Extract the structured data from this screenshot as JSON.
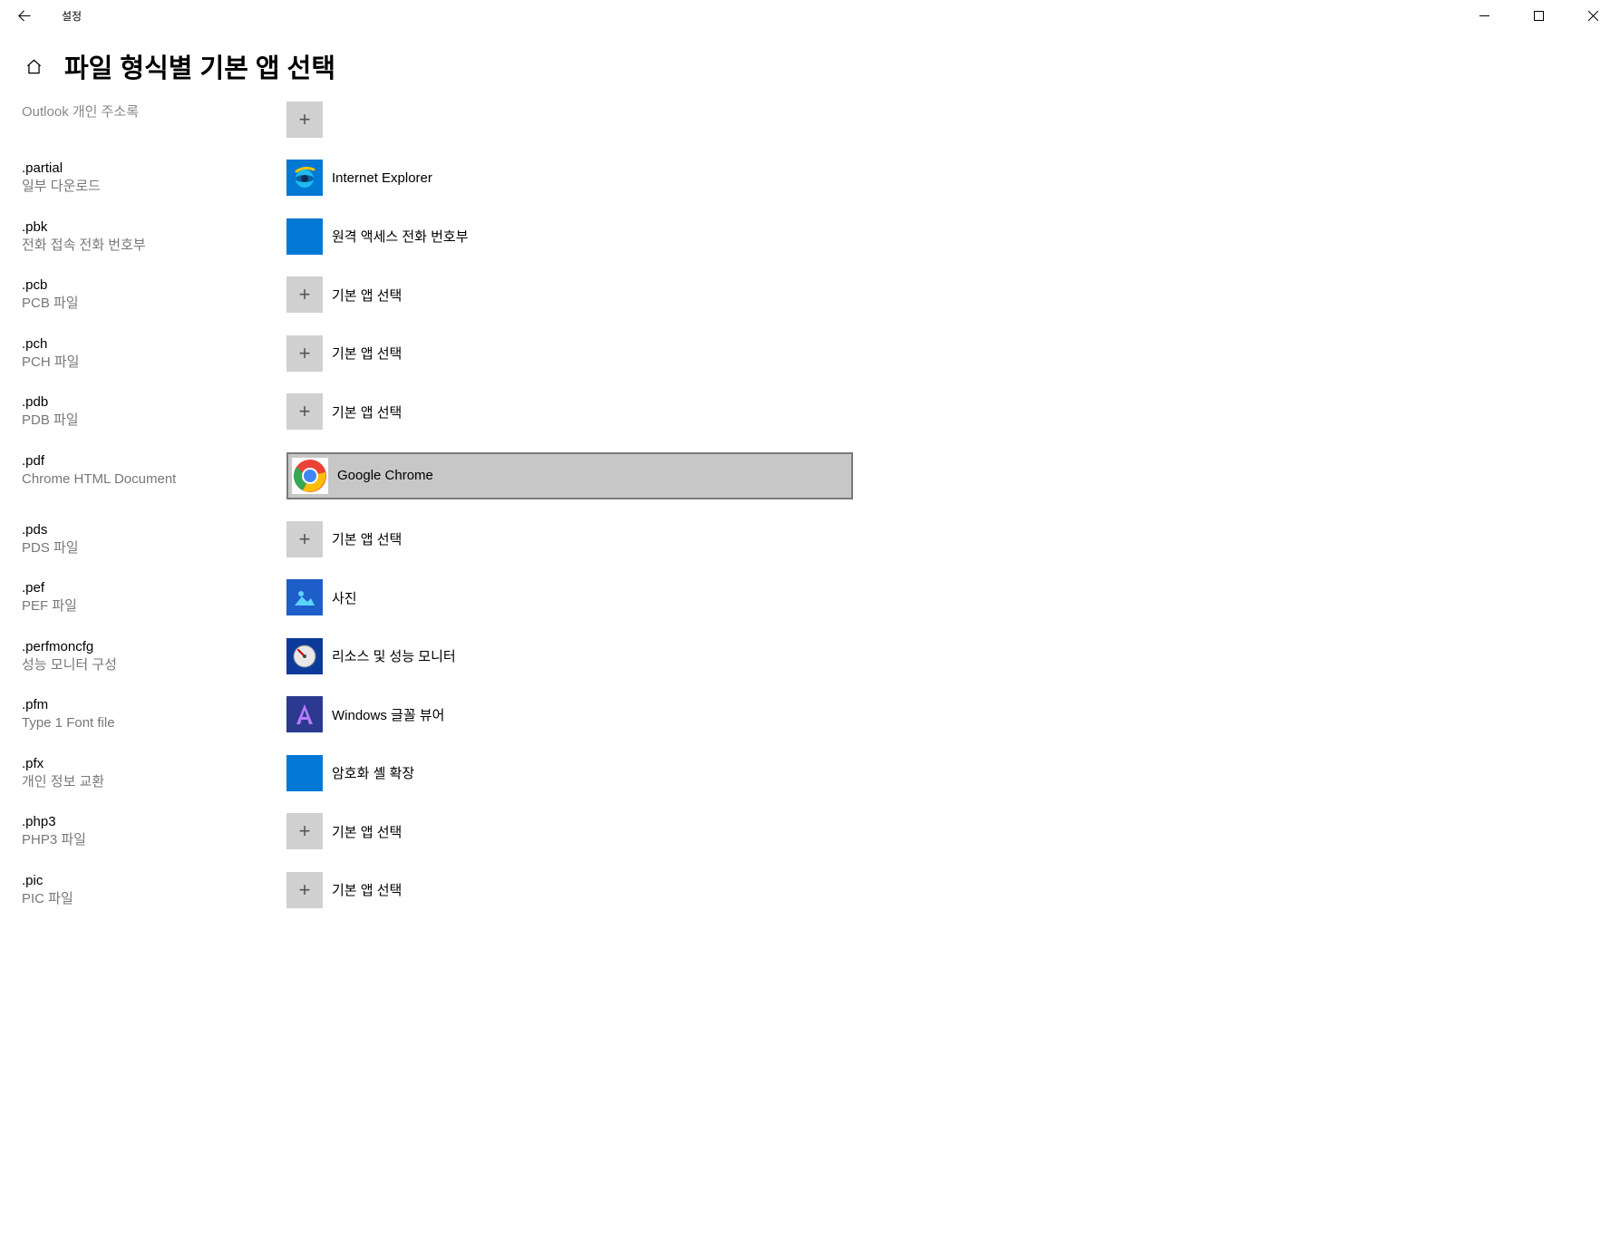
{
  "window": {
    "title": "설정"
  },
  "page": {
    "heading": "파일 형식별 기본 앱 선택"
  },
  "labels": {
    "choose_default": "기본 앱 선택"
  },
  "partial_top": {
    "desc": "Outlook 개인 주소록"
  },
  "rows": [
    {
      "ext": ".partial",
      "desc": "일부 다운로드",
      "app": "Internet Explorer",
      "icon": "ie"
    },
    {
      "ext": ".pbk",
      "desc": "전화 접속 전화 번호부",
      "app": "원격 액세스 전화 번호부",
      "icon": "blue"
    },
    {
      "ext": ".pcb",
      "desc": "PCB 파일",
      "app": "기본 앱 선택",
      "icon": "plus"
    },
    {
      "ext": ".pch",
      "desc": "PCH 파일",
      "app": "기본 앱 선택",
      "icon": "plus"
    },
    {
      "ext": ".pdb",
      "desc": "PDB 파일",
      "app": "기본 앱 선택",
      "icon": "plus"
    },
    {
      "ext": ".pdf",
      "desc": "Chrome HTML Document",
      "app": "Google Chrome",
      "icon": "chrome",
      "selected": true
    },
    {
      "ext": ".pds",
      "desc": "PDS 파일",
      "app": "기본 앱 선택",
      "icon": "plus"
    },
    {
      "ext": ".pef",
      "desc": "PEF 파일",
      "app": "사진",
      "icon": "photos"
    },
    {
      "ext": ".perfmoncfg",
      "desc": "성능 모니터 구성",
      "app": "리소스 및 성능 모니터",
      "icon": "perfmon"
    },
    {
      "ext": ".pfm",
      "desc": "Type 1 Font file",
      "app": "Windows 글꼴 뷰어",
      "icon": "font"
    },
    {
      "ext": ".pfx",
      "desc": "개인 정보 교환",
      "app": "암호화 셸 확장",
      "icon": "blue"
    },
    {
      "ext": ".php3",
      "desc": "PHP3 파일",
      "app": "기본 앱 선택",
      "icon": "plus"
    },
    {
      "ext": ".pic",
      "desc": "PIC 파일",
      "app": "기본 앱 선택",
      "icon": "plus"
    }
  ]
}
